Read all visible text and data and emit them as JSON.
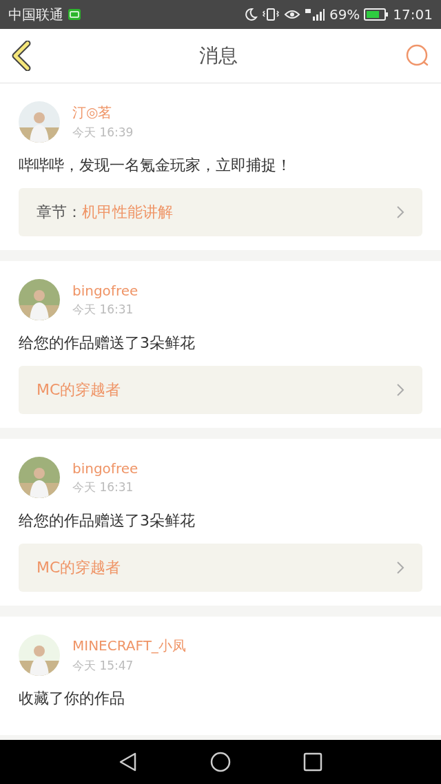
{
  "status_bar": {
    "carrier": "中国联通",
    "battery_percent": "69%",
    "time": "17:01"
  },
  "header": {
    "title": "消息"
  },
  "messages": [
    {
      "user": "汀◎茗",
      "time": "今天 16:39",
      "text": "哔哔哔，发现一名氪金玩家，立即捕捉！",
      "link": {
        "kind": "chapter",
        "prefix": "章节：",
        "title": "机甲性能讲解"
      }
    },
    {
      "user": "bingofree",
      "time": "今天 16:31",
      "text": "给您的作品赠送了3朵鲜花",
      "link": {
        "kind": "work",
        "title": "MC的穿越者"
      }
    },
    {
      "user": "bingofree",
      "time": "今天 16:31",
      "text": "给您的作品赠送了3朵鲜花",
      "link": {
        "kind": "work",
        "title": "MC的穿越者"
      }
    },
    {
      "user": "MINECRAFT_小凤",
      "time": "今天 15:47",
      "text": "收藏了你的作品"
    }
  ]
}
